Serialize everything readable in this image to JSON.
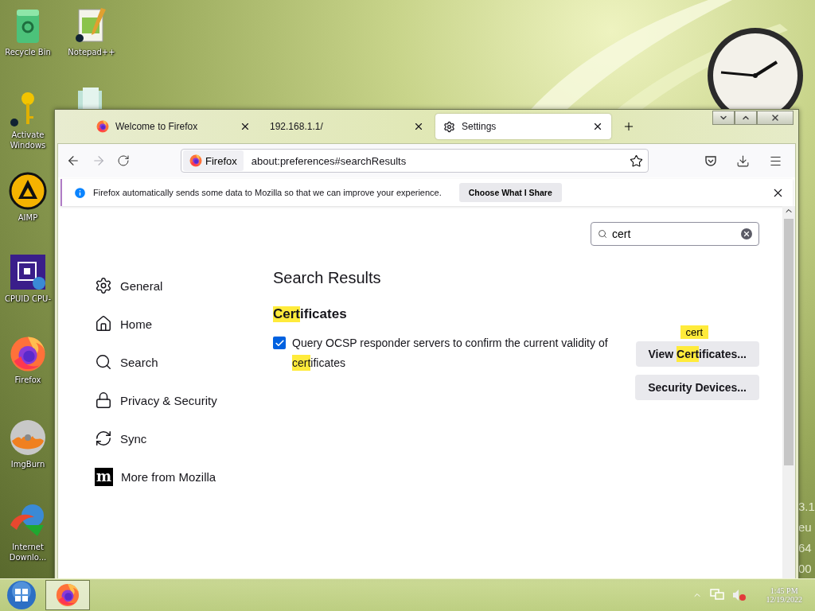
{
  "desktop": {
    "icons": [
      {
        "label": "Recycle Bin",
        "kind": "recycle"
      },
      {
        "label": "Notepad++",
        "kind": "notepad"
      },
      {
        "label": "Activate Windows",
        "kind": "key"
      },
      {
        "label": "AIMP",
        "kind": "aimp"
      },
      {
        "label": "CPUID CPU-",
        "kind": "cpu"
      },
      {
        "label": "Firefox",
        "kind": "firefox"
      },
      {
        "label": "ImgBurn",
        "kind": "disc"
      },
      {
        "label": "Internet Downlo...",
        "kind": "idm"
      }
    ],
    "side_text": [
      "3.1",
      "eu",
      "64",
      "00"
    ]
  },
  "browser": {
    "tabs": [
      {
        "title": "Welcome to Firefox",
        "selected": false,
        "kind": "firefox"
      },
      {
        "title": "192.168.1.1/",
        "selected": false,
        "kind": "none"
      },
      {
        "title": "Settings",
        "selected": true,
        "kind": "settings"
      }
    ],
    "address": {
      "identity": "Firefox",
      "url": "about:preferences#searchResults"
    },
    "notification": {
      "message": "Firefox automatically sends some data to Mozilla so that we can improve your experience.",
      "button": "Choose What I Share"
    },
    "search": {
      "value": "cert"
    },
    "sidebar": {
      "items": [
        {
          "label": "General",
          "kind": "general"
        },
        {
          "label": "Home",
          "kind": "home"
        },
        {
          "label": "Search",
          "kind": "search"
        },
        {
          "label": "Privacy & Security",
          "kind": "privacy"
        },
        {
          "label": "Sync",
          "kind": "sync"
        },
        {
          "label": "More from Mozilla",
          "kind": "mozilla",
          "icon_text": "m"
        }
      ]
    },
    "content": {
      "heading": "Search Results",
      "section_title": [
        {
          "text": "Cert",
          "highlighted": true
        },
        {
          "text": "ificates",
          "highlighted": false
        }
      ],
      "checkbox": {
        "checked": true,
        "label": [
          {
            "text": "Query OCSP responder servers to confirm the current validity of ",
            "highlighted": false
          },
          {
            "text": "cert",
            "highlighted": true
          },
          {
            "text": "ificates",
            "highlighted": false
          }
        ]
      },
      "buttons": [
        {
          "label": [
            {
              "text": "View ",
              "highlighted": false
            },
            {
              "text": "Cert",
              "highlighted": true
            },
            {
              "text": "ificates...",
              "highlighted": false
            }
          ],
          "tooltip": "cert"
        },
        {
          "label": [
            {
              "text": "Security Devices...",
              "highlighted": false
            }
          ]
        }
      ]
    }
  },
  "taskbar": {
    "clock": {
      "time": "1:45 PM",
      "date": "12/19/2022"
    }
  }
}
